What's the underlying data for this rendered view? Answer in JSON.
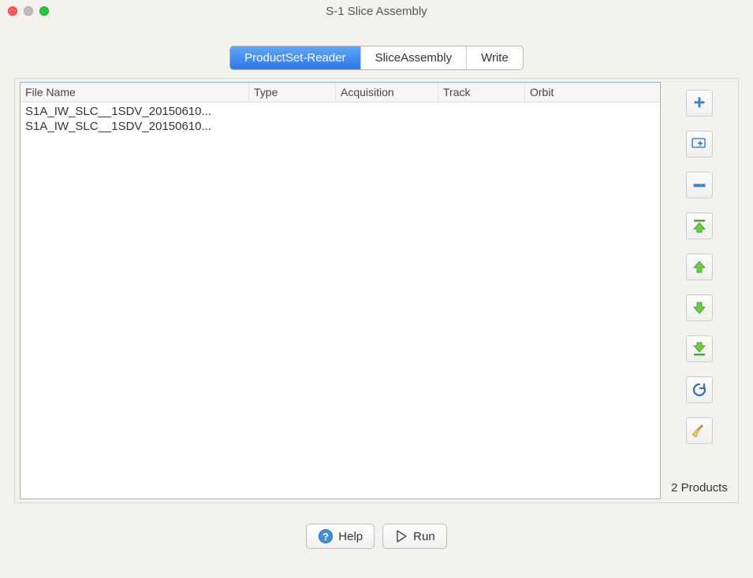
{
  "window": {
    "title": "S-1 Slice Assembly"
  },
  "tabs": [
    {
      "label": "ProductSet-Reader",
      "active": true
    },
    {
      "label": "SliceAssembly",
      "active": false
    },
    {
      "label": "Write",
      "active": false
    }
  ],
  "table": {
    "headers": {
      "file_name": "File Name",
      "type": "Type",
      "acquisition": "Acquisition",
      "track": "Track",
      "orbit": "Orbit"
    },
    "rows": [
      {
        "file_name": "S1A_IW_SLC__1SDV_20150610...",
        "type": "",
        "acquisition": "",
        "track": "",
        "orbit": ""
      },
      {
        "file_name": "S1A_IW_SLC__1SDV_20150610...",
        "type": "",
        "acquisition": "",
        "track": "",
        "orbit": ""
      }
    ]
  },
  "sidebar": {
    "count_label": "2 Products",
    "icons": {
      "add": "add",
      "add_folder": "add-folder",
      "remove": "remove",
      "move_top": "move-top",
      "move_up": "move-up",
      "move_down": "move-down",
      "move_bottom": "move-bottom",
      "refresh": "refresh",
      "clear": "clear"
    }
  },
  "footer": {
    "help_label": "Help",
    "run_label": "Run"
  }
}
